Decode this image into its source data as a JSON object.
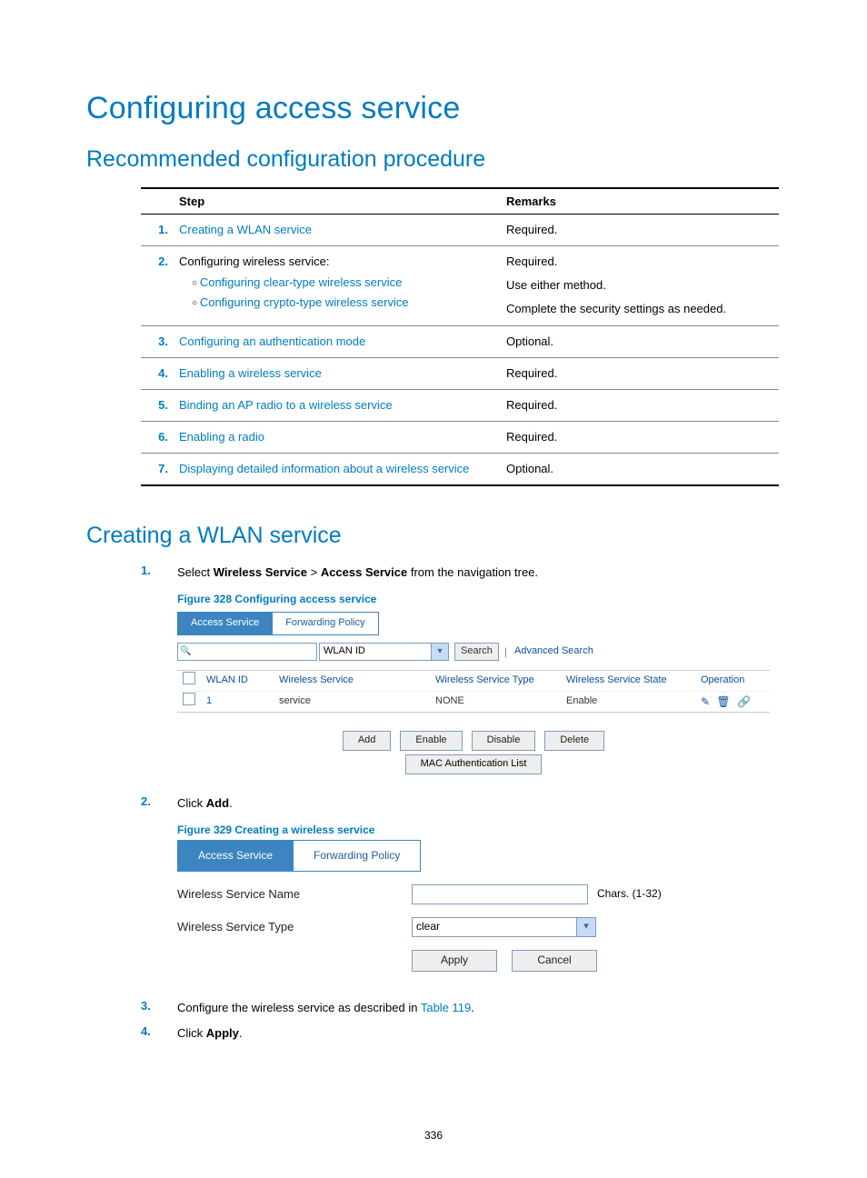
{
  "title": "Configuring access service",
  "h2a": "Recommended configuration procedure",
  "h2b": "Creating a WLAN service",
  "table_headers": {
    "step": "Step",
    "remarks": "Remarks"
  },
  "steps": {
    "1": {
      "label": "Creating a WLAN service",
      "remark": "Required."
    },
    "2": {
      "label": "Configuring wireless service:",
      "sub1": "Configuring clear-type wireless service",
      "sub2": "Configuring crypto-type wireless service",
      "r1": "Required.",
      "r2": "Use either method.",
      "r3": "Complete the security settings as needed."
    },
    "3": {
      "label": "Configuring an authentication mode",
      "remark": "Optional."
    },
    "4": {
      "label": "Enabling a wireless service",
      "remark": "Required."
    },
    "5": {
      "label": "Binding an AP radio to a wireless service",
      "remark": "Required."
    },
    "6": {
      "label": "Enabling a radio",
      "remark": "Required."
    },
    "7": {
      "label": "Displaying detailed information about a wireless service",
      "remark": "Optional."
    }
  },
  "ol": {
    "1a": "Select ",
    "1b": "Wireless Service",
    "1c": " > ",
    "1d": "Access Service",
    "1e": " from the navigation tree.",
    "fig328": "Figure 328 Configuring access service",
    "2a": "Click ",
    "2b": "Add",
    "2c": ".",
    "fig329": "Figure 329 Creating a wireless service",
    "3a": "Configure the wireless service as described in ",
    "3b": "Table 119",
    "3c": ".",
    "4a": "Click ",
    "4b": "Apply",
    "4c": "."
  },
  "fig328": {
    "tab1": "Access Service",
    "tab2": "Forwarding Policy",
    "dd": "WLAN ID",
    "search": "Search",
    "adv": "Advanced Search",
    "col_wlanid": "WLAN ID",
    "col_ws": "Wireless Service",
    "col_wst": "Wireless Service Type",
    "col_wss": "Wireless Service State",
    "col_op": "Operation",
    "row": {
      "id": "1",
      "ws": "service",
      "wst": "NONE",
      "wss": "Enable"
    },
    "btn_add": "Add",
    "btn_enable": "Enable",
    "btn_disable": "Disable",
    "btn_delete": "Delete",
    "btn_mac": "MAC Authentication List"
  },
  "fig329": {
    "tab1": "Access Service",
    "tab2": "Forwarding Policy",
    "lbl_name": "Wireless Service Name",
    "lbl_type": "Wireless Service Type",
    "hint": "Chars. (1-32)",
    "type_val": "clear",
    "apply": "Apply",
    "cancel": "Cancel"
  },
  "pagenum": "336"
}
